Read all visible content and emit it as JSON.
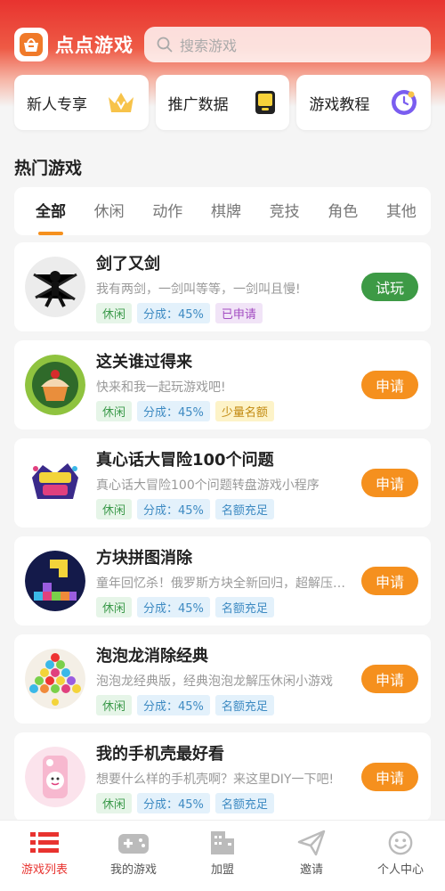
{
  "app": {
    "title": "点点游戏"
  },
  "search": {
    "placeholder": "搜索游戏"
  },
  "quick_links": [
    {
      "label": "新人专享",
      "icon": "crown-icon"
    },
    {
      "label": "推广数据",
      "icon": "chart-card-icon"
    },
    {
      "label": "游戏教程",
      "icon": "clock-icon"
    }
  ],
  "section": {
    "title": "热门游戏"
  },
  "tabs": [
    "全部",
    "休闲",
    "动作",
    "棋牌",
    "竞技",
    "角色",
    "其他"
  ],
  "games": [
    {
      "name": "剑了又剑",
      "desc": "我有两剑，一剑叫等等，一剑叫且慢!",
      "tag1": "休闲",
      "tag2": "分成：45%",
      "tag3": "已申请",
      "button": "试玩"
    },
    {
      "name": "这关谁过得来",
      "desc": "快来和我一起玩游戏吧!",
      "tag1": "休闲",
      "tag2": "分成：45%",
      "tag3": "少量名额",
      "button": "申请"
    },
    {
      "name": "真心话大冒险100个问题",
      "desc": "真心话大冒险100个问题转盘游戏小程序",
      "tag1": "休闲",
      "tag2": "分成：45%",
      "tag3": "名额充足",
      "button": "申请"
    },
    {
      "name": "方块拼图消除",
      "desc": "童年回忆杀！俄罗斯方块全新回归，超解压的经典游戏",
      "tag1": "休闲",
      "tag2": "分成：45%",
      "tag3": "名额充足",
      "button": "申请"
    },
    {
      "name": "泡泡龙消除经典",
      "desc": "泡泡龙经典版，经典泡泡龙解压休闲小游戏",
      "tag1": "休闲",
      "tag2": "分成：45%",
      "tag3": "名额充足",
      "button": "申请"
    },
    {
      "name": "我的手机壳最好看",
      "desc": "想要什么样的手机壳啊？来这里DIY一下吧!",
      "tag1": "休闲",
      "tag2": "分成：45%",
      "tag3": "名额充足",
      "button": "申请"
    }
  ],
  "nav": [
    {
      "label": "游戏列表"
    },
    {
      "label": "我的游戏"
    },
    {
      "label": "加盟"
    },
    {
      "label": "邀请"
    },
    {
      "label": "个人中心"
    }
  ],
  "colors": {
    "brand_red": "#e8332f",
    "accent_orange": "#f5901e",
    "try_green": "#3d9a45"
  }
}
